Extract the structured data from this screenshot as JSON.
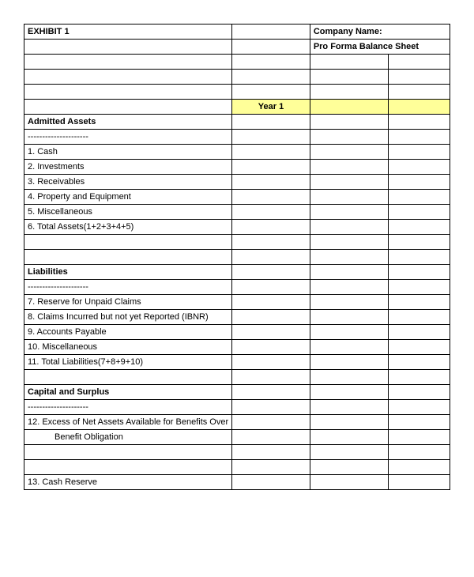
{
  "header": {
    "exhibit": "EXHIBIT 1",
    "company_label": "Company Name:",
    "subtitle": "Pro Forma Balance Sheet",
    "year_label": "Year 1"
  },
  "dashes": "---------------------",
  "sections": {
    "assets": {
      "title": "Admitted Assets",
      "rows": [
        "1.   Cash",
        "2.   Investments",
        "3.   Receivables",
        "4.   Property and Equipment",
        "5.   Miscellaneous",
        "6.   Total Assets(1+2+3+4+5)"
      ]
    },
    "liabilities": {
      "title": "Liabilities",
      "rows": [
        "7.   Reserve for Unpaid Claims",
        "8.   Claims Incurred but not yet Reported (IBNR)",
        "9.  Accounts Payable",
        "10.  Miscellaneous",
        "11.  Total Liabilities(7+8+9+10)"
      ]
    },
    "capital": {
      "title": "Capital and Surplus",
      "row12a": "12.   Excess of Net Assets Available for Benefits Over",
      "row12b": "Benefit Obligation",
      "row13": "13.  Cash Reserve"
    }
  }
}
